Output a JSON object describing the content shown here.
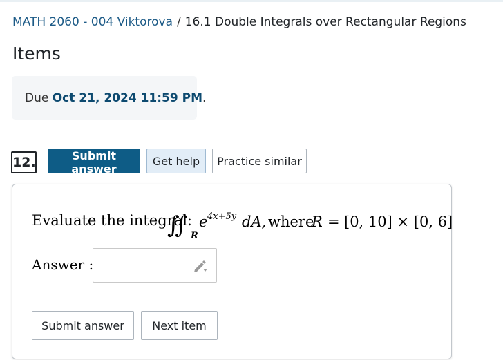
{
  "breadcrumb": {
    "course": "MATH 2060 - 004 Viktorova",
    "separator": "/",
    "current": "16.1 Double Integrals over Rectangular Regions"
  },
  "page_title": "Items",
  "due": {
    "prefix": "Due ",
    "date": "Oct 21, 2024 11:59 PM",
    "suffix": "."
  },
  "question": {
    "number": "12.",
    "buttons": {
      "submit": "Submit answer",
      "help": "Get help",
      "practice": "Practice similar"
    },
    "problem": {
      "lead": "Evaluate the integral:",
      "integral_symbol": "∬",
      "subscript": "R",
      "base": "e",
      "exponent": "4x+5y",
      "differential": "dA,",
      "where": "where",
      "region_var": "R",
      "equals": "=",
      "region": "[0, 10] × [0, 6]"
    },
    "answer_label": "Answer :",
    "answer_value": "",
    "input_icon": "pencil-dropdown-icon",
    "footer_buttons": {
      "submit": "Submit answer",
      "next": "Next item"
    }
  },
  "colors": {
    "primary": "#0e5c86",
    "link": "#1d5b87",
    "help_bg": "#e2edf7",
    "due_date": "#0d4a70"
  }
}
